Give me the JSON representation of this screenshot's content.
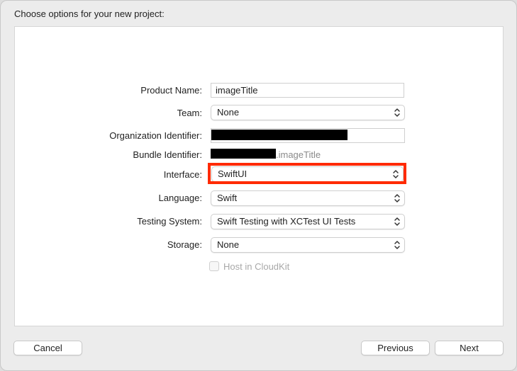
{
  "dialog": {
    "title": "Choose options for your new project:"
  },
  "form": {
    "product_name": {
      "label": "Product Name:",
      "value": "imageTitle"
    },
    "team": {
      "label": "Team:",
      "value": "None"
    },
    "organization_identifier": {
      "label": "Organization Identifier:",
      "value": ""
    },
    "bundle_identifier": {
      "label": "Bundle Identifier:",
      "suffix": ".imageTitle"
    },
    "interface": {
      "label": "Interface:",
      "value": "SwiftUI"
    },
    "language": {
      "label": "Language:",
      "value": "Swift"
    },
    "testing_system": {
      "label": "Testing System:",
      "value": "Swift Testing with XCTest UI Tests"
    },
    "storage": {
      "label": "Storage:",
      "value": "None"
    },
    "host_in_cloudkit": {
      "label": "Host in CloudKit",
      "checked": false,
      "enabled": false
    }
  },
  "buttons": {
    "cancel": "Cancel",
    "previous": "Previous",
    "next": "Next"
  },
  "colors": {
    "highlight": "#ff2a00",
    "redaction": "#000000"
  }
}
